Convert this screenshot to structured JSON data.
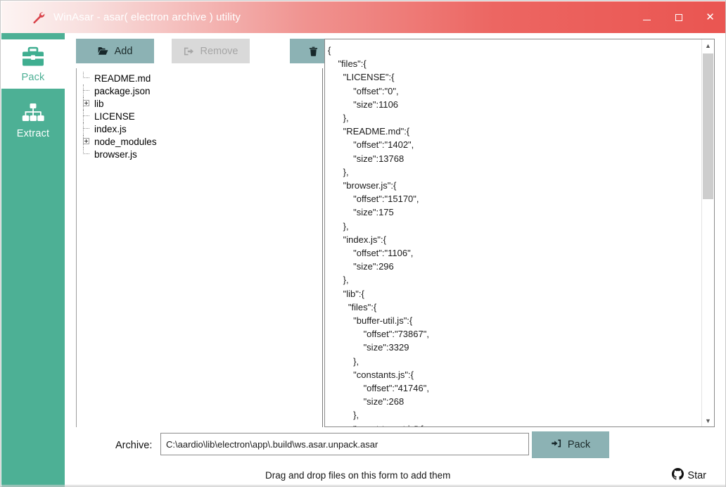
{
  "window": {
    "title": "WinAsar - asar( electron archive ) utility",
    "icon": "wrench-icon",
    "accent_gradient_start": "#fdf4f3",
    "accent_gradient_end": "#ea5551",
    "minimize_label": "–",
    "maximize_label": "□",
    "close_label": "✕"
  },
  "sidebar": {
    "background": "#4db095",
    "active_tab": "Pack",
    "tabs": [
      {
        "label": "Pack",
        "icon": "briefcase-icon",
        "active": true
      },
      {
        "label": "Extract",
        "icon": "sitemap-icon",
        "active": false
      }
    ]
  },
  "toolbar": {
    "button_color": "#8cb2b4",
    "buttons": [
      {
        "label": "Add",
        "icon": "folder-open-icon",
        "disabled": false
      },
      {
        "label": "Remove",
        "icon": "sign-out-icon",
        "disabled": true
      },
      {
        "label": "Clear",
        "icon": "trash-icon",
        "disabled": false
      }
    ]
  },
  "file_tree": {
    "items": [
      {
        "label": "README.md",
        "expandable": false
      },
      {
        "label": "package.json",
        "expandable": false
      },
      {
        "label": "lib",
        "expandable": true
      },
      {
        "label": "LICENSE",
        "expandable": false
      },
      {
        "label": "index.js",
        "expandable": false
      },
      {
        "label": "node_modules",
        "expandable": true
      },
      {
        "label": "browser.js",
        "expandable": false
      }
    ]
  },
  "json_view": {
    "content": "{\n    \"files\":{\n      \"LICENSE\":{\n          \"offset\":\"0\",\n          \"size\":1106\n      },\n      \"README.md\":{\n          \"offset\":\"1402\",\n          \"size\":13768\n      },\n      \"browser.js\":{\n          \"offset\":\"15170\",\n          \"size\":175\n      },\n      \"index.js\":{\n          \"offset\":\"1106\",\n          \"size\":296\n      },\n      \"lib\":{\n        \"files\":{\n          \"buffer-util.js\":{\n              \"offset\":\"73867\",\n              \"size\":3329\n          },\n          \"constants.js\":{\n              \"offset\":\"41746\",\n              \"size\":268\n          },\n          \"event-target.js\":{",
    "scroll_up_glyph": "▲",
    "scroll_down_glyph": "▼"
  },
  "archive": {
    "label": "Archive:",
    "value": "C:\\aardio\\lib\\electron\\app\\.build\\ws.asar.unpack.asar",
    "placeholder": "",
    "pack_button_label": "Pack",
    "pack_button_icon": "sign-in-icon"
  },
  "status": {
    "hint": "Drag and drop files on this form to add them",
    "star_label": "Star",
    "star_icon": "github-icon"
  }
}
